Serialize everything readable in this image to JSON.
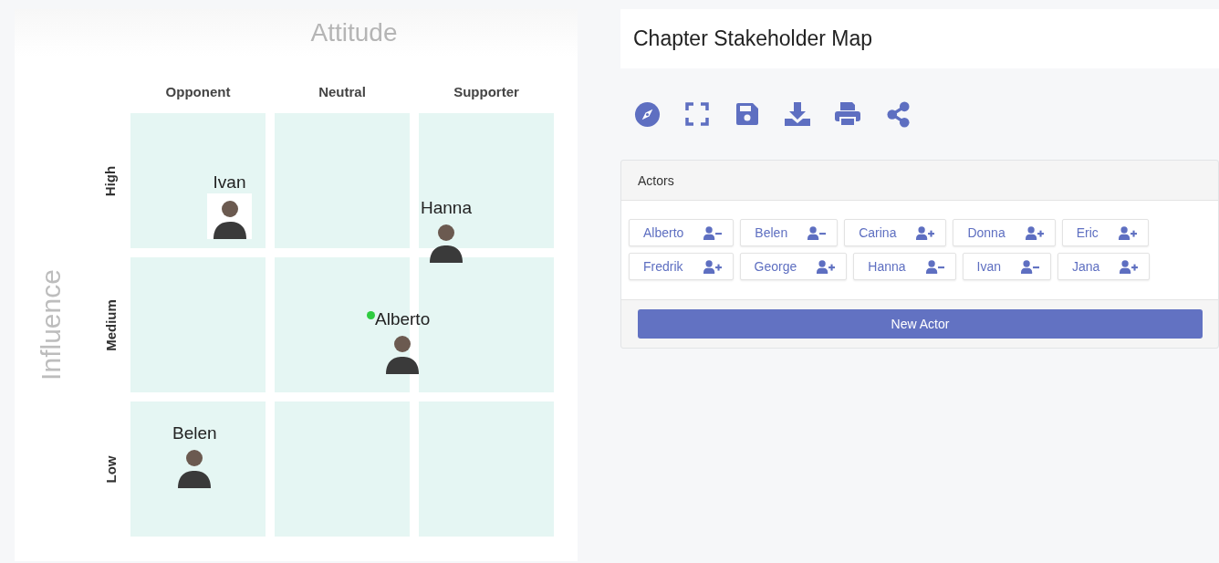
{
  "map": {
    "title": "Attitude",
    "columns": [
      "Opponent",
      "Neutral",
      "Supporter"
    ],
    "axis_label": "Influence",
    "rows": [
      "High",
      "Medium",
      "Low"
    ],
    "markers": [
      {
        "name": "Ivan",
        "active": false
      },
      {
        "name": "Hanna",
        "active": false
      },
      {
        "name": "Alberto",
        "active": true
      },
      {
        "name": "Belen",
        "active": false
      }
    ]
  },
  "header": {
    "title": "Chapter Stakeholder Map"
  },
  "actors": {
    "title": "Actors",
    "items": [
      {
        "name": "Alberto",
        "on_map": true
      },
      {
        "name": "Belen",
        "on_map": true
      },
      {
        "name": "Carina",
        "on_map": false
      },
      {
        "name": "Donna",
        "on_map": false
      },
      {
        "name": "Eric",
        "on_map": false
      },
      {
        "name": "Fredrik",
        "on_map": false
      },
      {
        "name": "George",
        "on_map": false
      },
      {
        "name": "Hanna",
        "on_map": true
      },
      {
        "name": "Ivan",
        "on_map": true
      },
      {
        "name": "Jana",
        "on_map": false
      }
    ],
    "button": "New Actor"
  }
}
